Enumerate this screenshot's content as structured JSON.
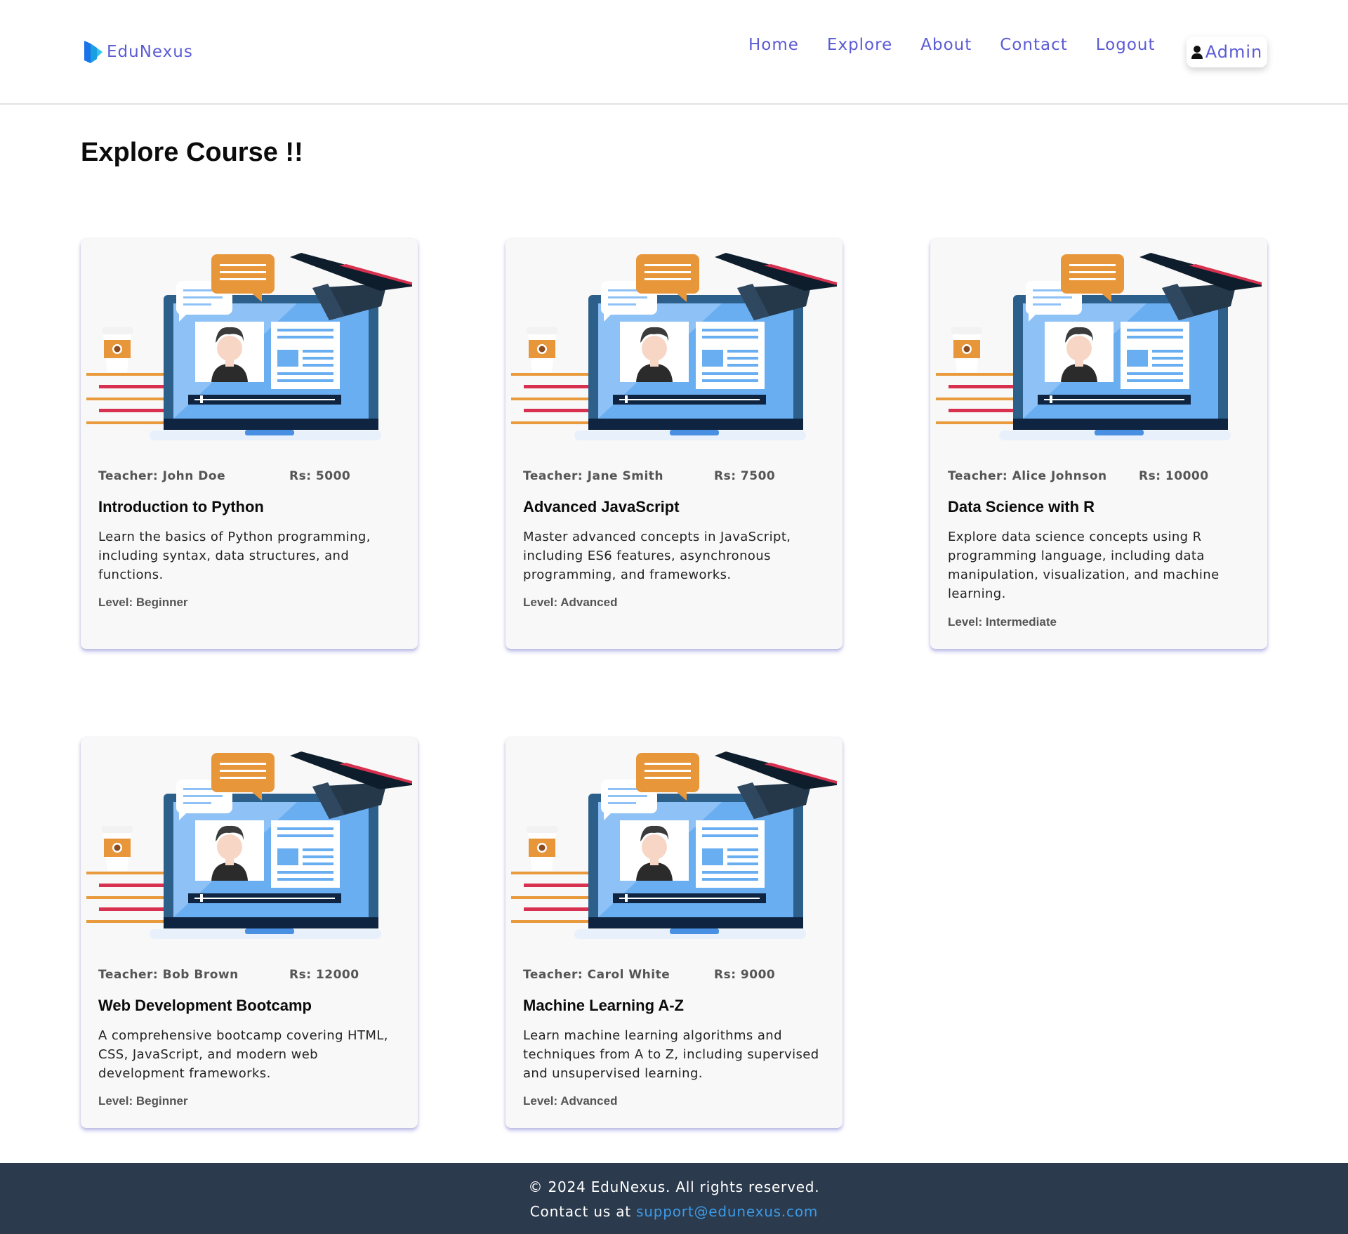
{
  "brand": {
    "name": "EduNexus"
  },
  "nav": {
    "items": [
      "Home",
      "Explore",
      "About",
      "Contact",
      "Logout"
    ],
    "admin_label": "Admin"
  },
  "page": {
    "title": "Explore Course !!"
  },
  "courses": [
    {
      "teacher": "Teacher: John Doe",
      "price": "Rs: 5000",
      "title": "Introduction to Python",
      "description": "Learn the basics of Python programming, including syntax, data structures, and functions.",
      "level": "Level: Beginner"
    },
    {
      "teacher": "Teacher: Jane Smith",
      "price": "Rs: 7500",
      "title": "Advanced JavaScript",
      "description": "Master advanced concepts in JavaScript, including ES6 features, asynchronous programming, and frameworks.",
      "level": "Level: Advanced"
    },
    {
      "teacher": "Teacher: Alice Johnson",
      "price": "Rs: 10000",
      "title": "Data Science with R",
      "description": "Explore data science concepts using R programming language, including data manipulation, visualization, and machine learning.",
      "level": "Level: Intermediate"
    },
    {
      "teacher": "Teacher: Bob Brown",
      "price": "Rs: 12000",
      "title": "Web Development Bootcamp",
      "description": "A comprehensive bootcamp covering HTML, CSS, JavaScript, and modern web development frameworks.",
      "level": "Level: Beginner"
    },
    {
      "teacher": "Teacher: Carol White",
      "price": "Rs: 9000",
      "title": "Machine Learning A-Z",
      "description": "Learn machine learning algorithms and techniques from A to Z, including supervised and unsupervised learning.",
      "level": "Level: Advanced"
    }
  ],
  "footer": {
    "copyright": "© 2024 EduNexus. All rights reserved.",
    "contact_prefix": "Contact us at",
    "email": "support@edunexus.com"
  },
  "colors": {
    "accent": "#5b5bd6",
    "footer_bg": "#2b3a4c",
    "link": "#3d9be9",
    "card_bg": "#f8f8f8"
  },
  "icons": {
    "logo": "play-book-logo-icon",
    "admin": "user-icon",
    "course_image": "online-course-laptop-illustration"
  }
}
